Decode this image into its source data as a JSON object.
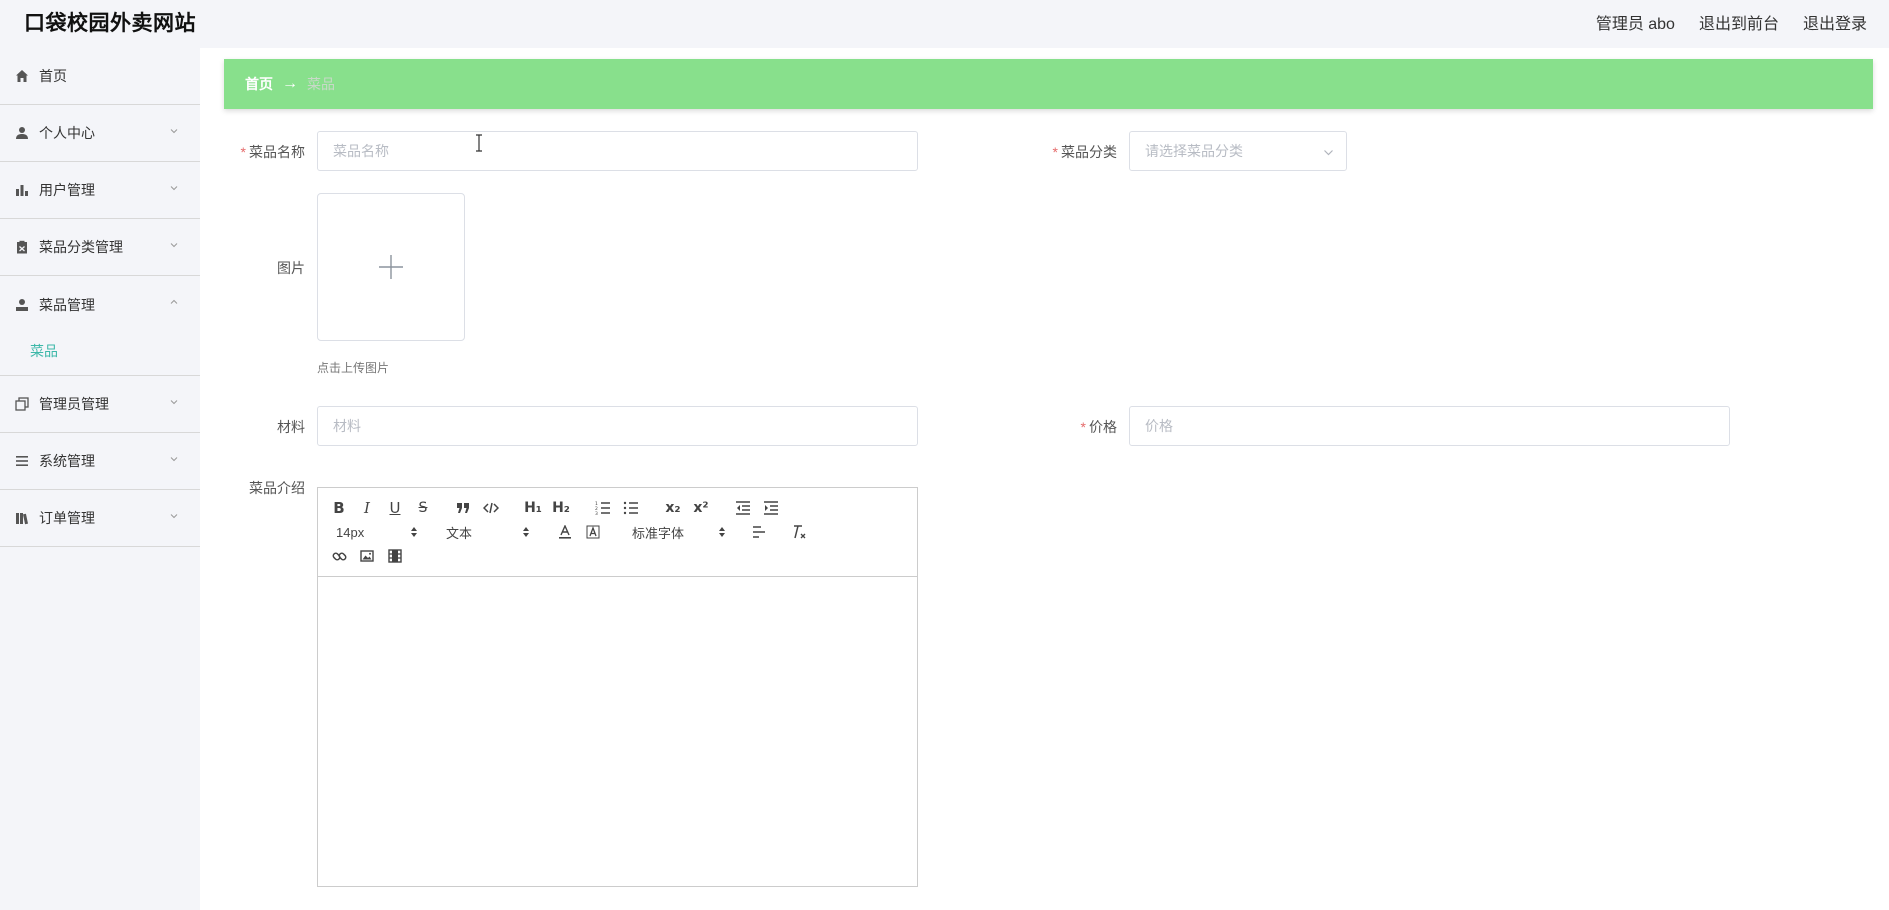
{
  "header": {
    "site_title": "口袋校园外卖网站",
    "admin_label": "管理员 abo",
    "to_frontend": "退出到前台",
    "logout": "退出登录"
  },
  "sidebar": {
    "items": [
      {
        "label": "首页",
        "icon": "home-icon"
      },
      {
        "label": "个人中心",
        "icon": "user-icon"
      },
      {
        "label": "用户管理",
        "icon": "bar-chart-icon"
      },
      {
        "label": "菜品分类管理",
        "icon": "clipboard-icon"
      },
      {
        "label": "菜品管理",
        "icon": "person-icon",
        "expanded": true,
        "children": [
          "菜品"
        ]
      },
      {
        "label": "管理员管理",
        "icon": "copy-icon"
      },
      {
        "label": "系统管理",
        "icon": "list-icon"
      },
      {
        "label": "订单管理",
        "icon": "library-icon"
      }
    ]
  },
  "breadcrumb": {
    "home": "首页",
    "arrow": "→",
    "current": "菜品"
  },
  "form": {
    "required_mark": "*",
    "name_label": "菜品名称",
    "name_placeholder": "菜品名称",
    "category_label": "菜品分类",
    "category_placeholder": "请选择菜品分类",
    "image_label": "图片",
    "upload_tip": "点击上传图片",
    "material_label": "材料",
    "material_placeholder": "材料",
    "price_label": "价格",
    "price_placeholder": "价格",
    "intro_label": "菜品介绍"
  },
  "editor": {
    "font_size": "14px",
    "header_picker": "文本",
    "font_family": "标准字体",
    "buttons": {
      "bold": "B",
      "italic": "I",
      "underline": "U",
      "strike": "S",
      "h1": "H₁",
      "h2": "H₂",
      "sub": "x₂",
      "sup": "x²"
    }
  },
  "colors": {
    "breadcrumb_bg": "#88e08c",
    "active_submenu": "#3db8a9",
    "required": "#e56a6a"
  }
}
